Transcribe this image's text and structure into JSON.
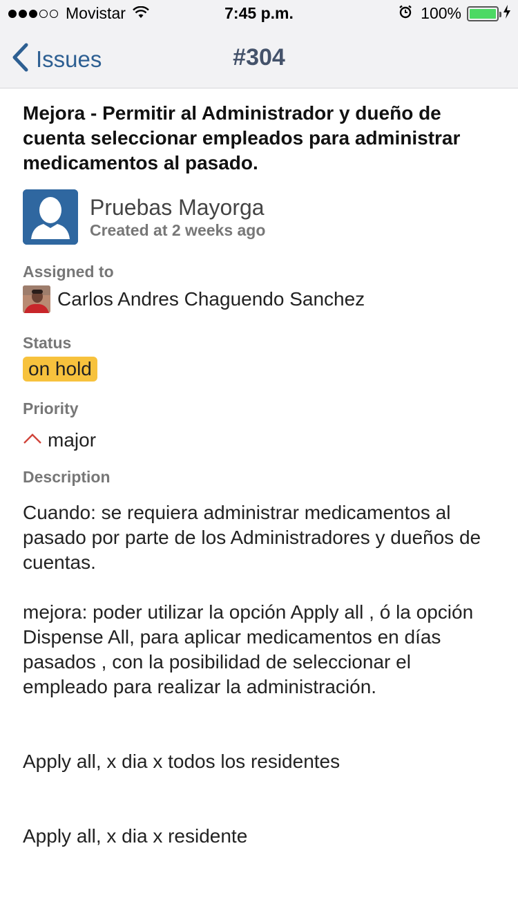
{
  "status_bar": {
    "carrier": "Movistar",
    "time": "7:45 p.m.",
    "battery": "100%",
    "signal_dots_filled": 3,
    "signal_dots_total": 5
  },
  "nav": {
    "back_label": "Issues",
    "title": "#304"
  },
  "issue": {
    "title": "Mejora - Permitir al Administrador y dueño de cuenta seleccionar empleados para administrar medicamentos al pasado.",
    "author_name": "Pruebas Mayorga",
    "created": "Created at 2 weeks ago",
    "assigned_label": "Assigned to",
    "assignee": "Carlos Andres Chaguendo Sanchez",
    "status_label": "Status",
    "status": "on hold",
    "priority_label": "Priority",
    "priority": "major",
    "description_label": "Description",
    "description": {
      "p1": "Cuando:  se requiera administrar medicamentos al pasado por parte de los Administradores y dueños de cuentas.",
      "p2": "mejora: poder utilizar la opción Apply all , ó la opción Dispense All, para aplicar medicamentos en días pasados , con la posibilidad de seleccionar el empleado para realizar la administración.",
      "p3": "Apply all, x dia x todos los residentes",
      "p4": "Apply all, x dia x residente"
    }
  },
  "colors": {
    "nav_tint": "#2d5f92",
    "status_badge": "#f7c23d",
    "priority_icon": "#d0443a",
    "avatar_bg": "#2f67a0"
  }
}
